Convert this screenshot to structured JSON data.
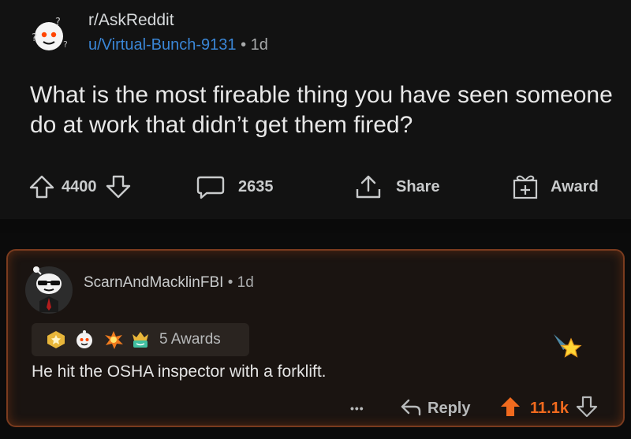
{
  "post": {
    "subreddit": "r/AskReddit",
    "user": "u/Virtual-Bunch-9131",
    "separator": "•",
    "age": "1d",
    "title": "What is the most fireable thing you have seen someone do at work that didn’t get them fired?",
    "votes": "4400",
    "comments": "2635",
    "share_label": "Share",
    "award_label": "Award"
  },
  "comment": {
    "user": "ScarnAndMacklinFBI",
    "separator": "•",
    "age": "1d",
    "awards_count": "5 Awards",
    "text": "He hit the OSHA inspector with a forklift.",
    "more": "•••",
    "reply_label": "Reply",
    "score": "11.1k"
  },
  "colors": {
    "background": "#121212",
    "username_link": "#3a86d6",
    "upvote_active": "#f06a1e",
    "comment_border": "#7a3b1e"
  },
  "icons": [
    "subreddit-avatar-icon",
    "upvote-icon",
    "downvote-icon",
    "comment-icon",
    "share-icon",
    "award-icon",
    "user-avatar-icon",
    "award-badge-icon",
    "reply-icon",
    "more-icon"
  ]
}
